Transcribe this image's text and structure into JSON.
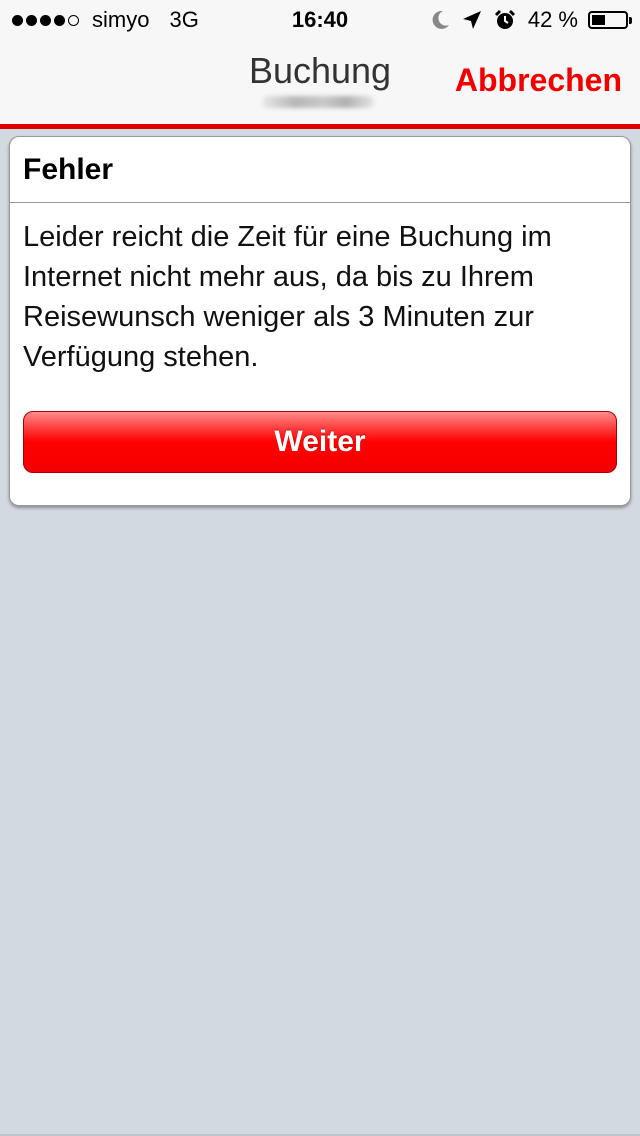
{
  "status_bar": {
    "carrier": "simyo",
    "network": "3G",
    "time": "16:40",
    "battery_percent": "42 %",
    "battery_level": 0.42
  },
  "nav": {
    "title": "Buchung",
    "cancel_label": "Abbrechen"
  },
  "dialog": {
    "title": "Fehler",
    "message": "Leider reicht die Zeit für eine Buchung im Internet nicht mehr aus, da bis zu Ihrem Reisewunsch weniger als 3 Minuten zur Verfügung stehen.",
    "button_label": "Weiter"
  },
  "colors": {
    "accent": "#f20000",
    "background": "#d3d9e0"
  },
  "icons": [
    "signal-dots-icon",
    "moon-icon",
    "location-arrow-icon",
    "alarm-clock-icon",
    "battery-icon"
  ]
}
